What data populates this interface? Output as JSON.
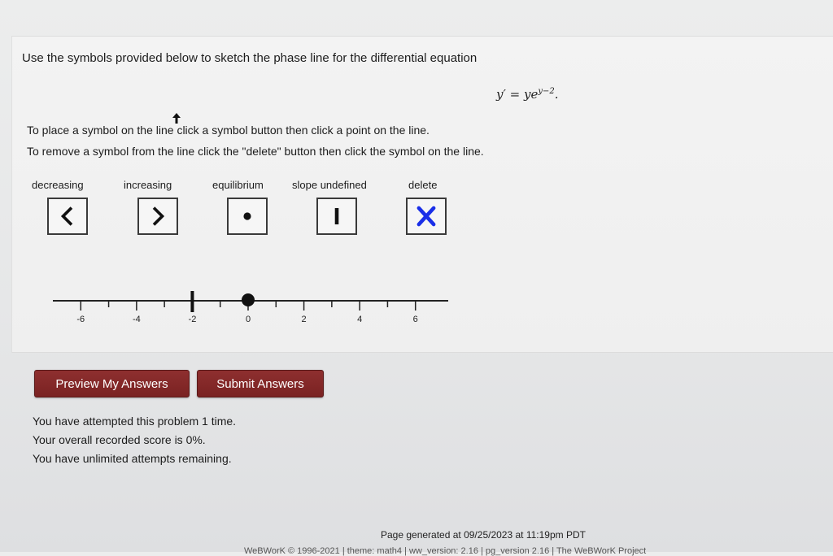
{
  "problem": {
    "intro": "Use the symbols provided below to sketch the phase line for the differential equation",
    "equation": {
      "lhs": "y′ = ye",
      "exponent": "y−2",
      "end": "."
    },
    "instructions": [
      "To place a symbol on the line click a symbol button then click a point on the line.",
      "To remove a symbol from the line click the \"delete\" button then click the symbol on the line."
    ]
  },
  "palette": {
    "decreasing": "decreasing",
    "increasing": "increasing",
    "equilibrium": "equilibrium",
    "slope_undefined": "slope undefined",
    "delete": "delete"
  },
  "phase_line": {
    "axis_range": [
      -7,
      7
    ],
    "major_ticks": [
      -6,
      -4,
      -2,
      0,
      2,
      4,
      6
    ],
    "tick_labels": [
      "-6",
      "-4",
      "-2",
      "0",
      "2",
      "4",
      "6"
    ],
    "minor_ticks": [
      -5,
      -3,
      -1,
      1,
      3,
      5
    ],
    "placed_symbols": [
      {
        "type": "slope-undefined",
        "x": -2
      },
      {
        "type": "equilibrium",
        "x": 0
      }
    ]
  },
  "buttons": {
    "preview": "Preview My Answers",
    "submit": "Submit Answers"
  },
  "status": {
    "attempts": "You have attempted this problem 1 time.",
    "score": "Your overall recorded score is 0%.",
    "remaining": "You have unlimited attempts remaining."
  },
  "footer": {
    "generated": "Page generated at 09/25/2023 at 11:19pm PDT",
    "copyright": "WeBWorK © 1996-2021 | theme: math4 | ww_version: 2.16 | pg_version 2.16 | The WeBWorK Project"
  },
  "colors": {
    "accent": "#7e2525",
    "delete_icon": "#1a2fe8",
    "panel_bg": "#f1f1f1"
  }
}
